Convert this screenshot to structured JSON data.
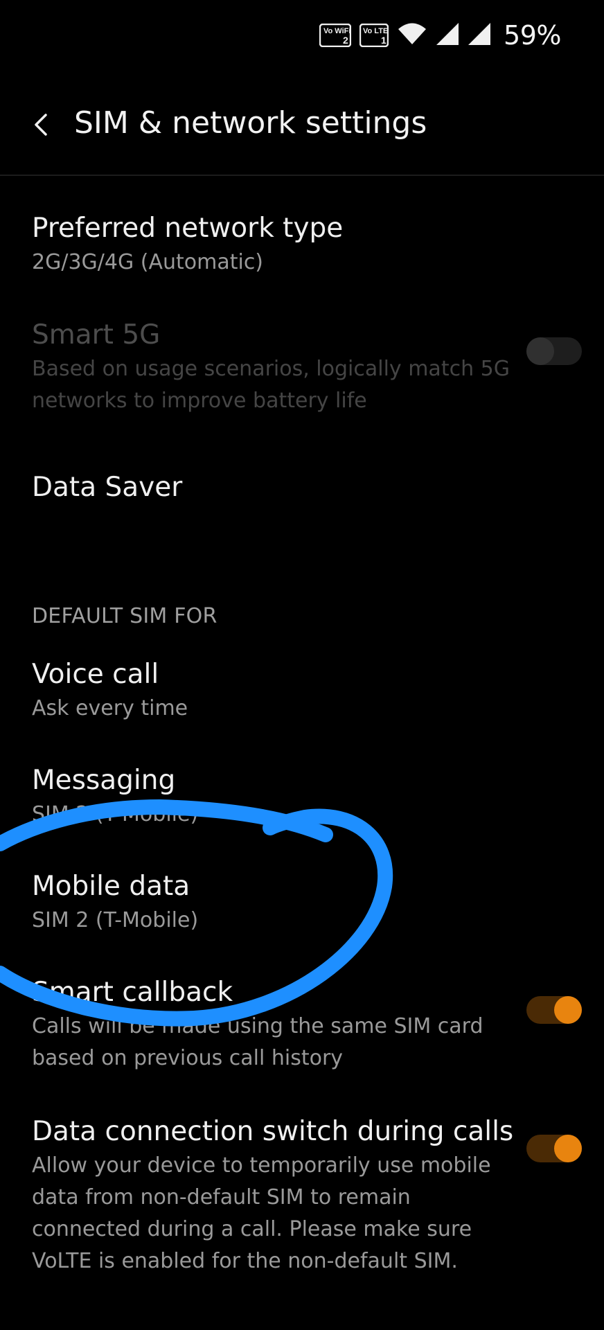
{
  "status_bar": {
    "vowifi_label": "Vo WiFi",
    "vowifi_index": "2",
    "volte_label": "Vo LTE",
    "volte_index": "1",
    "battery": "59%"
  },
  "header": {
    "title": "SIM & network settings"
  },
  "items": {
    "preferred_network": {
      "title": "Preferred network type",
      "subtitle": "2G/3G/4G (Automatic)"
    },
    "smart_5g": {
      "title": "Smart 5G",
      "subtitle": "Based on usage scenarios, logically match 5G networks to improve battery life",
      "enabled": false,
      "disabled": true
    },
    "data_saver": {
      "title": "Data Saver"
    },
    "default_sim_header": "DEFAULT SIM FOR",
    "voice_call": {
      "title": "Voice call",
      "subtitle": "Ask every time"
    },
    "messaging": {
      "title": "Messaging",
      "subtitle": "SIM 2  (T-Mobile)"
    },
    "mobile_data": {
      "title": "Mobile data",
      "subtitle": "SIM 2  (T-Mobile)"
    },
    "smart_callback": {
      "title": "Smart callback",
      "subtitle": "Calls will be made using the same SIM card based on previous call history",
      "enabled": true
    },
    "data_switch": {
      "title": "Data connection switch during calls",
      "subtitle": "Allow your device to temporarily use mobile data from non-default SIM to remain connected during a call. Please make sure VoLTE is enabled for the non-default SIM.",
      "enabled": true
    }
  },
  "colors": {
    "background": "#000000",
    "accent": "#e8840f",
    "annotation": "#1e8fff"
  },
  "icons": [
    "back-arrow-icon",
    "vowifi-icon",
    "volte-icon",
    "wifi-icon",
    "signal-icon"
  ]
}
